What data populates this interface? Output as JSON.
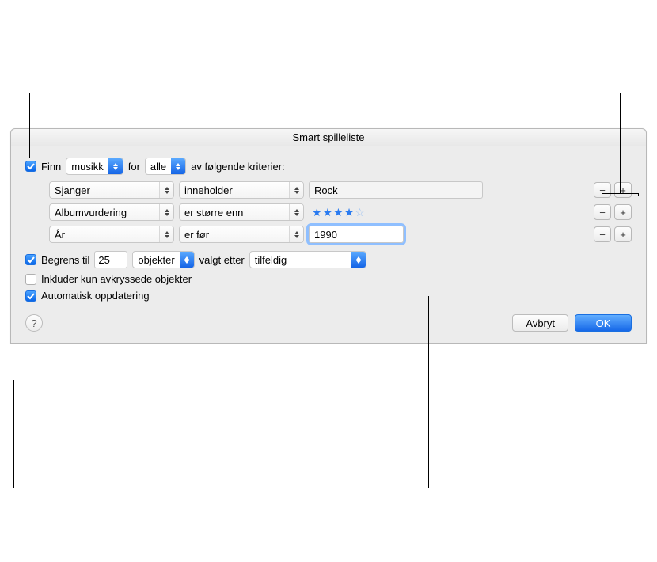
{
  "dialog": {
    "title": "Smart spilleliste",
    "match_row": {
      "find_label": "Finn",
      "media_select": "musikk",
      "for_label": "for",
      "match_mode": "alle",
      "criteria_label": "av følgende kriterier:"
    },
    "rules": [
      {
        "field": "Sjanger",
        "operator": "inneholder",
        "value": "Rock",
        "value_type": "text"
      },
      {
        "field": "Albumvurdering",
        "operator": "er større enn",
        "value": "4",
        "value_type": "stars"
      },
      {
        "field": "År",
        "operator": "er før",
        "value": "1990",
        "value_type": "text_focused"
      }
    ],
    "limit_row": {
      "limit_label": "Begrens til",
      "limit_value": "25",
      "unit_select": "objekter",
      "selected_by_label": "valgt etter",
      "sort_select": "tilfeldig"
    },
    "only_checked_label": "Inkluder kun avkryssede objekter",
    "live_update_label": "Automatisk oppdatering",
    "buttons": {
      "help": "?",
      "cancel": "Avbryt",
      "ok": "OK"
    }
  }
}
